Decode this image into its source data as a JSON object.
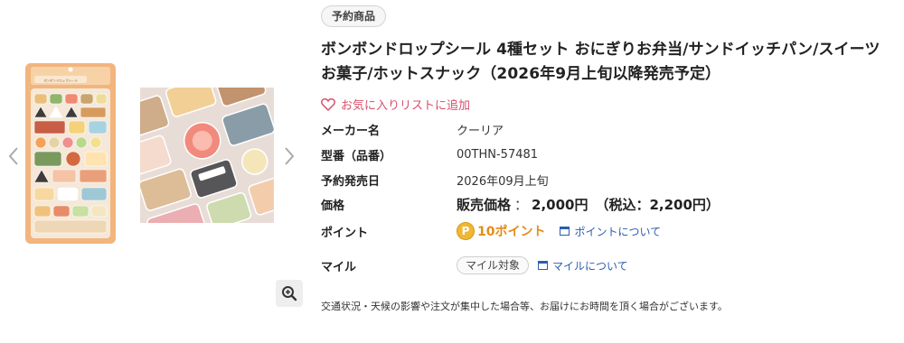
{
  "gallery": {
    "thumbnails": [
      {
        "name": "sticker-sheet",
        "label": "ボンボンドロップシール"
      },
      {
        "name": "sticker-closeup"
      }
    ],
    "icons": {
      "prev": "chevron-left-icon",
      "next": "chevron-right-icon",
      "zoom": "zoom-in-icon"
    }
  },
  "product": {
    "badge": "予約商品",
    "title": "ボンボンドロップシール 4種セット おにぎりお弁当/サンドイッチパン/スイーツお菓子/ホットスナック（2026年9月上旬以降発売予定）",
    "favorite_label": "お気に入りリストに追加",
    "maker_label": "メーカー名",
    "maker_value": "クーリア",
    "model_label": "型番（品番）",
    "model_value": "00THN-57481",
    "release_label": "予約発売日",
    "release_value": "2026年09月上旬",
    "price_label": "価格",
    "price_prefix": "販売価格",
    "price_colon": "：",
    "price_value": "2,000円",
    "price_tax": "（税込：2,200円）",
    "point_label": "ポイント",
    "point_coin": "P",
    "point_value": "10ポイント",
    "point_link": "ポイントについて",
    "mile_label": "マイル",
    "mile_badge": "マイル対象",
    "mile_link": "マイルについて",
    "notice": "交通状況・天候の影響や注文が集中した場合等、お届けにお時間を頂く場合がございます。"
  },
  "colors": {
    "heart": "#d94f6b",
    "link": "#2a5db0",
    "points": "#e38d1a",
    "coin": "#f0b733"
  }
}
